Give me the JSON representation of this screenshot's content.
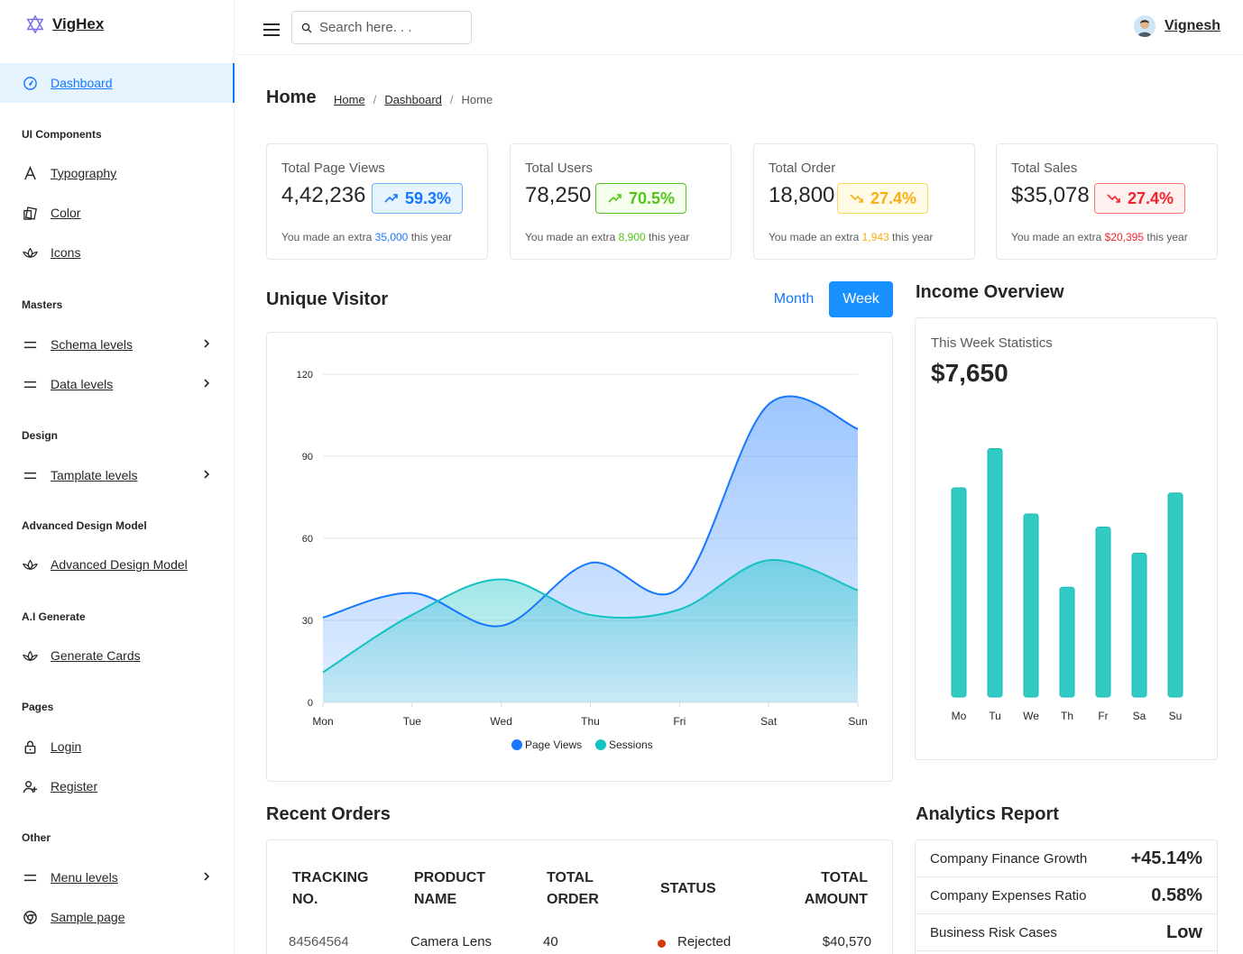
{
  "app": {
    "name": "VigHex"
  },
  "sidebar": {
    "dashboard": "Dashboard",
    "sections": {
      "ui": "UI Components",
      "masters": "Masters",
      "design": "Design",
      "adm": "Advanced Design Model",
      "ai": "A.I Generate",
      "pages": "Pages",
      "other": "Other"
    },
    "items": {
      "typography": "Typography",
      "color": "Color",
      "icons": "Icons",
      "schema": "Schema levels",
      "data": "Data levels",
      "template": "Tamplate levels",
      "adm": "Advanced Design Model",
      "generate": "Generate Cards",
      "login": "Login",
      "register": "Register",
      "menu": "Menu levels",
      "sample": "Sample page"
    }
  },
  "header": {
    "search_placeholder": "Search here. . .",
    "user_name": "Vignesh"
  },
  "page": {
    "title": "Home",
    "breadcrumb": [
      "Home",
      "Dashboard",
      "Home"
    ]
  },
  "stats": [
    {
      "title": "Total Page Views",
      "value": "4,42,236",
      "change": "59.3%",
      "trend": "up",
      "note_pre": "You made an extra",
      "note_val": "35,000",
      "note_post": "this year",
      "color": "#1677ff",
      "bg": "#e6f4ff",
      "border": "#69b1ff"
    },
    {
      "title": "Total Users",
      "value": "78,250",
      "change": "70.5%",
      "trend": "up",
      "note_pre": "You made an extra",
      "note_val": "8,900",
      "note_post": "this year",
      "color": "#52c41a",
      "bg": "#f6ffed",
      "border": "#52c41a"
    },
    {
      "title": "Total Order",
      "value": "18,800",
      "change": "27.4%",
      "trend": "down",
      "note_pre": "You made an extra",
      "note_val": "1,943",
      "note_post": "this year",
      "color": "#faad14",
      "bg": "#fffbe6",
      "border": "#ffd666"
    },
    {
      "title": "Total Sales",
      "value": "$35,078",
      "change": "27.4%",
      "trend": "down",
      "note_pre": "You made an extra",
      "note_val": "$20,395",
      "note_post": "this year",
      "color": "#f5222d",
      "bg": "#fff1f0",
      "border": "#ff7875"
    }
  ],
  "visitor": {
    "title": "Unique Visitor",
    "month_label": "Month",
    "week_label": "Week",
    "selected": "Week"
  },
  "income": {
    "title": "Income Overview",
    "subtitle": "This Week Statistics",
    "amount": "$7,650"
  },
  "chart_data": [
    {
      "type": "area",
      "categories": [
        "Mon",
        "Tue",
        "Wed",
        "Thu",
        "Fri",
        "Sat",
        "Sun"
      ],
      "series": [
        {
          "name": "Page Views",
          "values": [
            31,
            40,
            28,
            51,
            42,
            109,
            100
          ],
          "color": "#1677ff"
        },
        {
          "name": "Sessions",
          "values": [
            11,
            32,
            45,
            32,
            34,
            52,
            41
          ],
          "color": "#13c2c2"
        }
      ],
      "yticks": [
        0,
        30,
        60,
        90,
        120
      ],
      "ylim": [
        0,
        120
      ],
      "legend": "bottom",
      "grid": true
    },
    {
      "type": "bar",
      "categories": [
        "Mo",
        "Tu",
        "We",
        "Th",
        "Fr",
        "Sa",
        "Su"
      ],
      "values": [
        80,
        95,
        70,
        42,
        65,
        55,
        78
      ],
      "ylim": [
        0,
        100
      ],
      "color": "#31cbc6"
    }
  ],
  "orders": {
    "title": "Recent Orders",
    "headers": [
      "TRACKING NO.",
      "PRODUCT NAME",
      "TOTAL ORDER",
      "STATUS",
      "TOTAL AMOUNT"
    ],
    "rows": [
      {
        "tracking": "84564564",
        "product": "Camera Lens",
        "qty": "40",
        "status": "Rejected",
        "status_color": "#d4380d",
        "amount": "$40,570"
      }
    ]
  },
  "analytics": {
    "title": "Analytics Report",
    "rows": [
      {
        "label": "Company Finance Growth",
        "value": "+45.14%"
      },
      {
        "label": "Company Expenses Ratio",
        "value": "0.58%"
      },
      {
        "label": "Business Risk Cases",
        "value": "Low"
      }
    ]
  }
}
